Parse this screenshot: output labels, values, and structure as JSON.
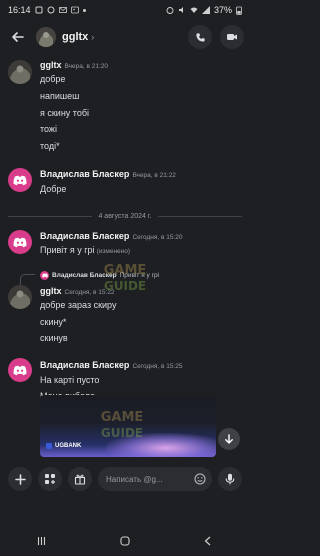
{
  "status_bar": {
    "time": "16:14",
    "battery": "37%"
  },
  "header": {
    "title": "ggltx",
    "chevron": "›"
  },
  "messages": [
    {
      "author": "ggltx",
      "timestamp": "Вчера, в 21:20",
      "lines": [
        "добре",
        "напишеш",
        "я скину тобі",
        "тожі",
        "тоді*"
      ]
    },
    {
      "author": "Владислав Бласкер",
      "timestamp": "Вчера, в 21:22",
      "lines": [
        "Добре"
      ]
    },
    {
      "author": "Владислав Бласкер",
      "timestamp": "Сегодня, в 15:20",
      "lines": [
        "Привіт я у грі"
      ],
      "edited": "(изменено)"
    },
    {
      "author": "ggltx",
      "timestamp": "Сегодня, в 15:22",
      "lines": [
        "добре зараз скиру",
        "скину*",
        "скинув"
      ]
    },
    {
      "author": "Владислав Бласкер",
      "timestamp": "Сегодня, в 15:25",
      "lines": [
        "На карті пусто",
        "Мене вибело"
      ]
    }
  ],
  "date_divider": "4 августа 2024 г.",
  "reply_preview": {
    "author": "Владислав Бласкер",
    "text": "Привіт я у грі"
  },
  "attachment": {
    "bank_label": "UGBANK"
  },
  "composer": {
    "placeholder": "Написать @g..."
  },
  "watermark": {
    "top": "GAME",
    "bottom": "GUIDE"
  },
  "colors": {
    "background": "#1e1f22",
    "avatar_discord": "#d83c8a",
    "accent_blue": "#5865f2"
  }
}
